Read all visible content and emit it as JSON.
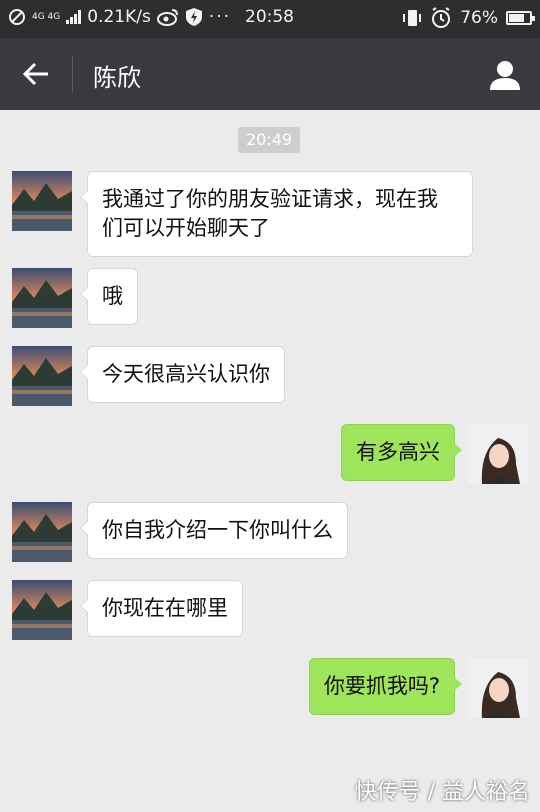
{
  "status_bar": {
    "network_type": "4G 4G",
    "speed": "0.21K/s",
    "time": "20:58",
    "battery_percent": "76%",
    "battery_level": 0.76
  },
  "header": {
    "back_icon": "arrow-left-icon",
    "title": "陈欣",
    "profile_icon": "person-icon"
  },
  "chat": {
    "timestamp": "20:49",
    "messages": [
      {
        "from": "contact",
        "text": "我通过了你的朋友验证请求，现在我们可以开始聊天了"
      },
      {
        "from": "contact",
        "text": "哦"
      },
      {
        "from": "contact",
        "text": "今天很高兴认识你"
      },
      {
        "from": "me",
        "text": "有多高兴"
      },
      {
        "from": "contact",
        "text": "你自我介绍一下你叫什么"
      },
      {
        "from": "contact",
        "text": "你现在在哪里"
      },
      {
        "from": "me",
        "text": "你要抓我吗?"
      }
    ]
  },
  "watermark": "快传号 / 益人裕名",
  "colors": {
    "status_bar": "#2e2e2e",
    "title_bar": "#393a3f",
    "chat_bg": "#ebebeb",
    "my_bubble": "#9fe55b",
    "their_bubble": "#ffffff"
  }
}
